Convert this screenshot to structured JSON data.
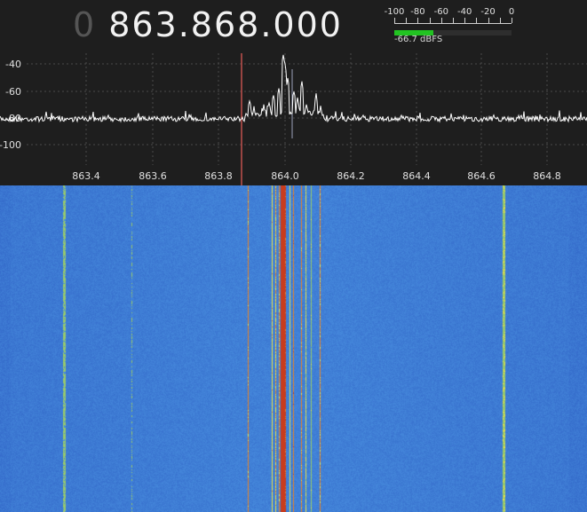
{
  "header": {
    "frequency_lead_digit": "0",
    "frequency": "863.868.000"
  },
  "level_meter": {
    "scale_labels": [
      "-100",
      "-80",
      "-60",
      "-40",
      "-20",
      "0"
    ],
    "scale_values": [
      -100,
      -80,
      -60,
      -40,
      -20,
      0
    ],
    "level_dbfs": -66.7,
    "readout": "-66.7 dBFS",
    "fill_color": "#22c322"
  },
  "spectrum": {
    "y_tick_labels": [
      "-40",
      "-60",
      "-80",
      "-100"
    ],
    "x_tick_labels": [
      "863.4",
      "863.6",
      "863.8",
      "864.0",
      "864.2",
      "864.4",
      "864.6",
      "864.8"
    ],
    "tuned_frequency_mhz": 863.868,
    "center_frequency_mhz": 864.04,
    "trace_color": "#ffffff",
    "tuning_marker_color": "#c0504d",
    "center_marker_color": "#9aa0b8",
    "background_color": "#1e1e1e",
    "grid_color": "#4a4a4a"
  },
  "waterfall": {
    "base_color": "#3a63c8",
    "signal_colors": [
      "#f0e040",
      "#e07a20",
      "#c83a1e"
    ]
  }
}
